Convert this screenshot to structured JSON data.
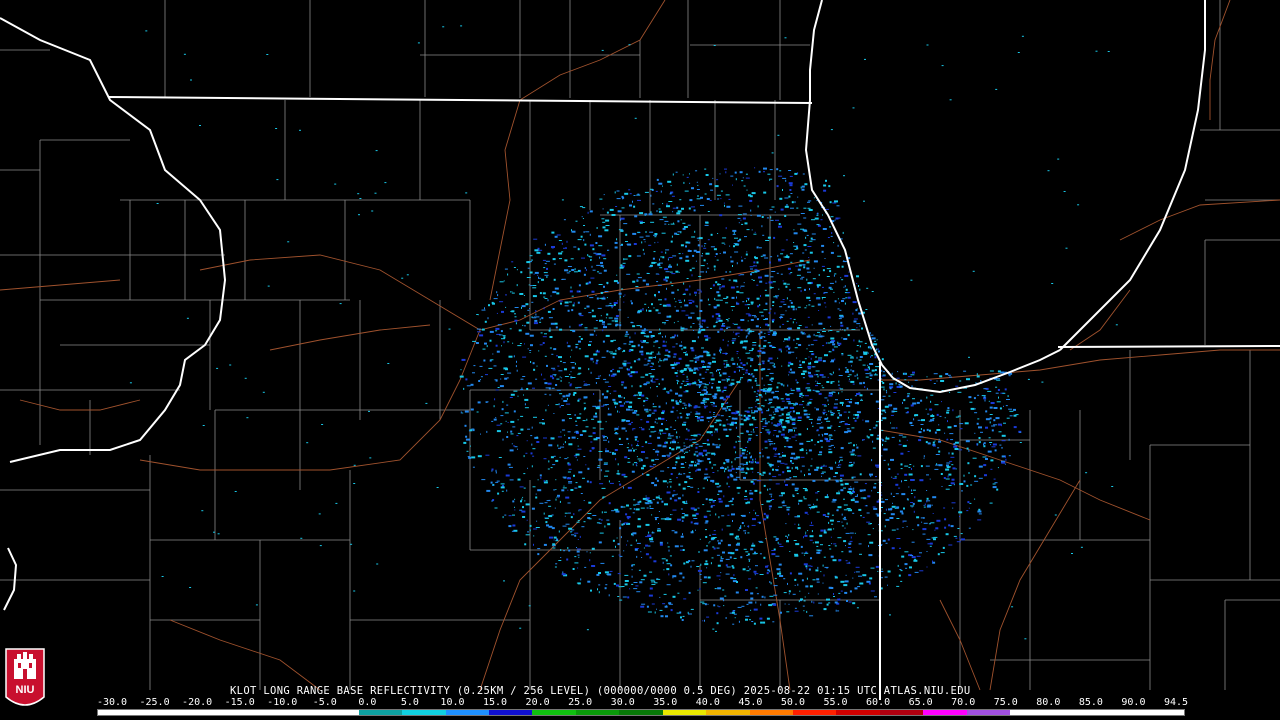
{
  "product_caption": "KLOT LONG RANGE BASE REFLECTIVITY (0.25KM / 256 LEVEL) (000000/0000 0.5 DEG) 2025-08-22 01:15 UTC  ATLAS.NIU.EDU",
  "logo": {
    "text": "NIU",
    "color": "#c8102e"
  },
  "color_scale": {
    "labels": [
      "-30.0",
      "-25.0",
      "-20.0",
      "-15.0",
      "-10.0",
      "-5.0",
      "0.0",
      "5.0",
      "10.0",
      "15.0",
      "20.0",
      "25.0",
      "30.0",
      "35.0",
      "40.0",
      "45.0",
      "50.0",
      "55.0",
      "60.0",
      "65.0",
      "70.0",
      "75.0",
      "80.0",
      "85.0",
      "90.0",
      "94.5"
    ],
    "colors": [
      "#ffffff",
      "#ffffff",
      "#ffffff",
      "#ffffff",
      "#ffffff",
      "#ffffff",
      "#0ea0a0",
      "#10d0e0",
      "#1e90ff",
      "#1010d0",
      "#10c010",
      "#0a9a0a",
      "#087808",
      "#e8e800",
      "#f0b400",
      "#ff7a00",
      "#ff2000",
      "#d00000",
      "#b00010",
      "#ff00ff",
      "#a050e0",
      "#ffffff",
      "#ffffff",
      "#ffffff",
      "#ffffff"
    ]
  },
  "map_colors": {
    "background": "#000000",
    "state_border": "#ffffff",
    "county_border": "#8a8a8a",
    "highway": "#a0522d",
    "echo_light": "#18c8e8",
    "echo_mid": "#2288ee",
    "echo_dark": "#1a3ad8"
  }
}
